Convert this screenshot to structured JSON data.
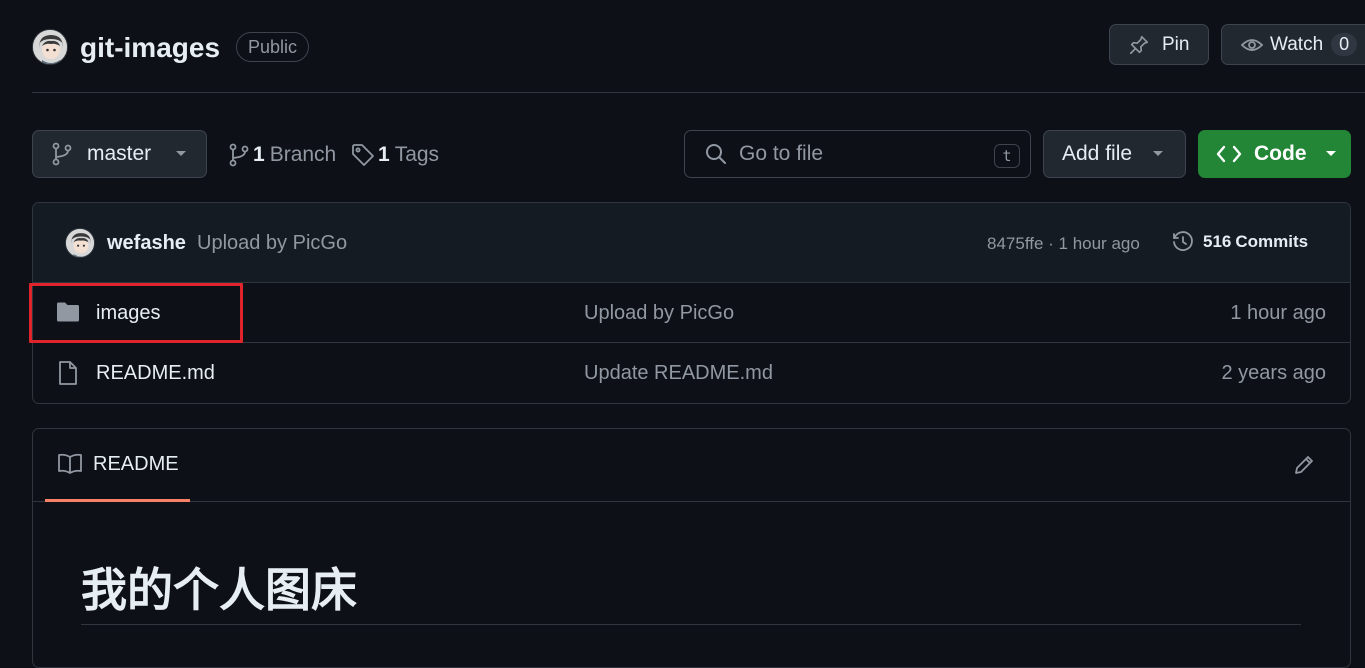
{
  "repo": {
    "name": "git-images",
    "visibility": "Public",
    "pin_label": "Pin",
    "watch_label": "Watch",
    "watch_count": "0"
  },
  "toolbar": {
    "branch_name": "master",
    "branch_count": "1",
    "branch_label": "Branch",
    "tag_count": "1",
    "tag_label": "Tags",
    "search_placeholder": "Go to file",
    "search_shortcut": "t",
    "add_file_label": "Add file",
    "code_label": "Code"
  },
  "latest_commit": {
    "author": "wefashe",
    "message": "Upload by PicGo",
    "hash_time": "8475ffe · 1 hour ago",
    "commits_count": "516",
    "commits_label": "Commits"
  },
  "files": [
    {
      "name": "images",
      "type": "folder",
      "message": "Upload by PicGo",
      "time": "1 hour ago"
    },
    {
      "name": "README.md",
      "type": "file",
      "message": "Update README.md",
      "time": "2 years ago"
    }
  ],
  "readme": {
    "tab_label": "README",
    "heading": "我的个人图床"
  },
  "colors": {
    "background": "#0d1117",
    "accent_green": "#238636",
    "highlight_red": "#e0242b",
    "tab_underline": "#f78166"
  }
}
